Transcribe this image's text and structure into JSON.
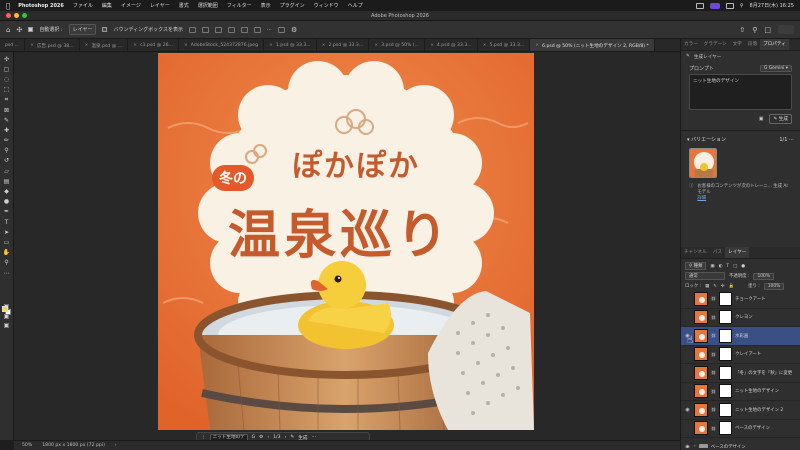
{
  "menubar": {
    "app": "Photoshop 2026",
    "items": [
      "ファイル",
      "編集",
      "イメージ",
      "レイヤー",
      "書式",
      "選択範囲",
      "フィルター",
      "表示",
      "プラグイン",
      "ウィンドウ",
      "ヘルプ"
    ],
    "clock": "8月27日(木) 16:25"
  },
  "window": {
    "title": "Adobe Photoshop 2026"
  },
  "options": {
    "auto_select_label": "自動選択 :",
    "auto_select_value": "レイヤー",
    "bounding_box_label": "バウンディングボックスを表示"
  },
  "tabs": [
    {
      "label": "psd ...",
      "active": false
    },
    {
      "label": "広告.psd @ 38...",
      "active": false
    },
    {
      "label": "温泉.psd @ ...",
      "active": false
    },
    {
      "label": "c1.psd @ 26...",
      "active": false
    },
    {
      "label": "AdobeStock_524372876.jpeg",
      "active": false
    },
    {
      "label": "1.psd @ 33.3...",
      "active": false
    },
    {
      "label": "2.psd @ 33.3...",
      "active": false
    },
    {
      "label": "3.psd @ 50% (...",
      "active": false
    },
    {
      "label": "4.psd @ 33.3...",
      "active": false
    },
    {
      "label": "5.psd @ 33.3...",
      "active": false
    },
    {
      "label": "6.psd @ 50% (ニット生地のデザイン 2, RGB/8) *",
      "active": true
    }
  ],
  "artwork": {
    "title_small": "ぽかぽか",
    "title_badge": "冬の",
    "title_main": "温泉巡り"
  },
  "context_bar": {
    "input_value": "ニット生地のデ",
    "page": "1/3",
    "generate": "生成"
  },
  "status": {
    "zoom": "50%",
    "doc_info": "1800 px x 1800 px (72 ppi)"
  },
  "panel_tabs": [
    "カラー",
    "グラデーシ",
    "文字",
    "段落",
    "プロパティ"
  ],
  "properties": {
    "header": "生成レイヤー",
    "prompt_label": "プロンプト",
    "model": "Gemini",
    "prompt_value": "ニット生地のデザイン",
    "generate_label": "生成",
    "variations_label": "バリエーション",
    "variations_count": "1/1",
    "note": "お客様のコンテンツが次のトレーニ... 生成 AI モデル",
    "note_link": "詳細"
  },
  "layer_tabs": [
    "チャンネル",
    "パス",
    "レイヤー"
  ],
  "layer_controls": {
    "filter": "種類",
    "blend": "通常",
    "opacity_label": "不透明度 :",
    "opacity": "100%",
    "lock_label": "ロック :",
    "fill_label": "塗り :",
    "fill": "100%"
  },
  "layers": [
    {
      "name": "チョークアート",
      "visible": false,
      "selected": false,
      "group": false
    },
    {
      "name": "クレヨン",
      "visible": false,
      "selected": false,
      "group": false
    },
    {
      "name": "水彩画",
      "visible": true,
      "selected": true,
      "group": false
    },
    {
      "name": "クレイアート",
      "visible": false,
      "selected": false,
      "group": false
    },
    {
      "name": "「冬」の文字を「秋」に変更",
      "visible": false,
      "selected": false,
      "group": false
    },
    {
      "name": "ニット生地のデザイン",
      "visible": false,
      "selected": false,
      "group": false
    },
    {
      "name": "ニット生地のデザイン 2",
      "visible": true,
      "selected": false,
      "group": false
    },
    {
      "name": "ベースのデザイン",
      "visible": false,
      "selected": false,
      "group": false
    },
    {
      "name": "ベースのデザイン",
      "visible": true,
      "selected": false,
      "group": true
    }
  ],
  "colors": {
    "accent": "#3a4f86",
    "poster_orange": "#e8753a",
    "title_red": "#c55a2c"
  }
}
